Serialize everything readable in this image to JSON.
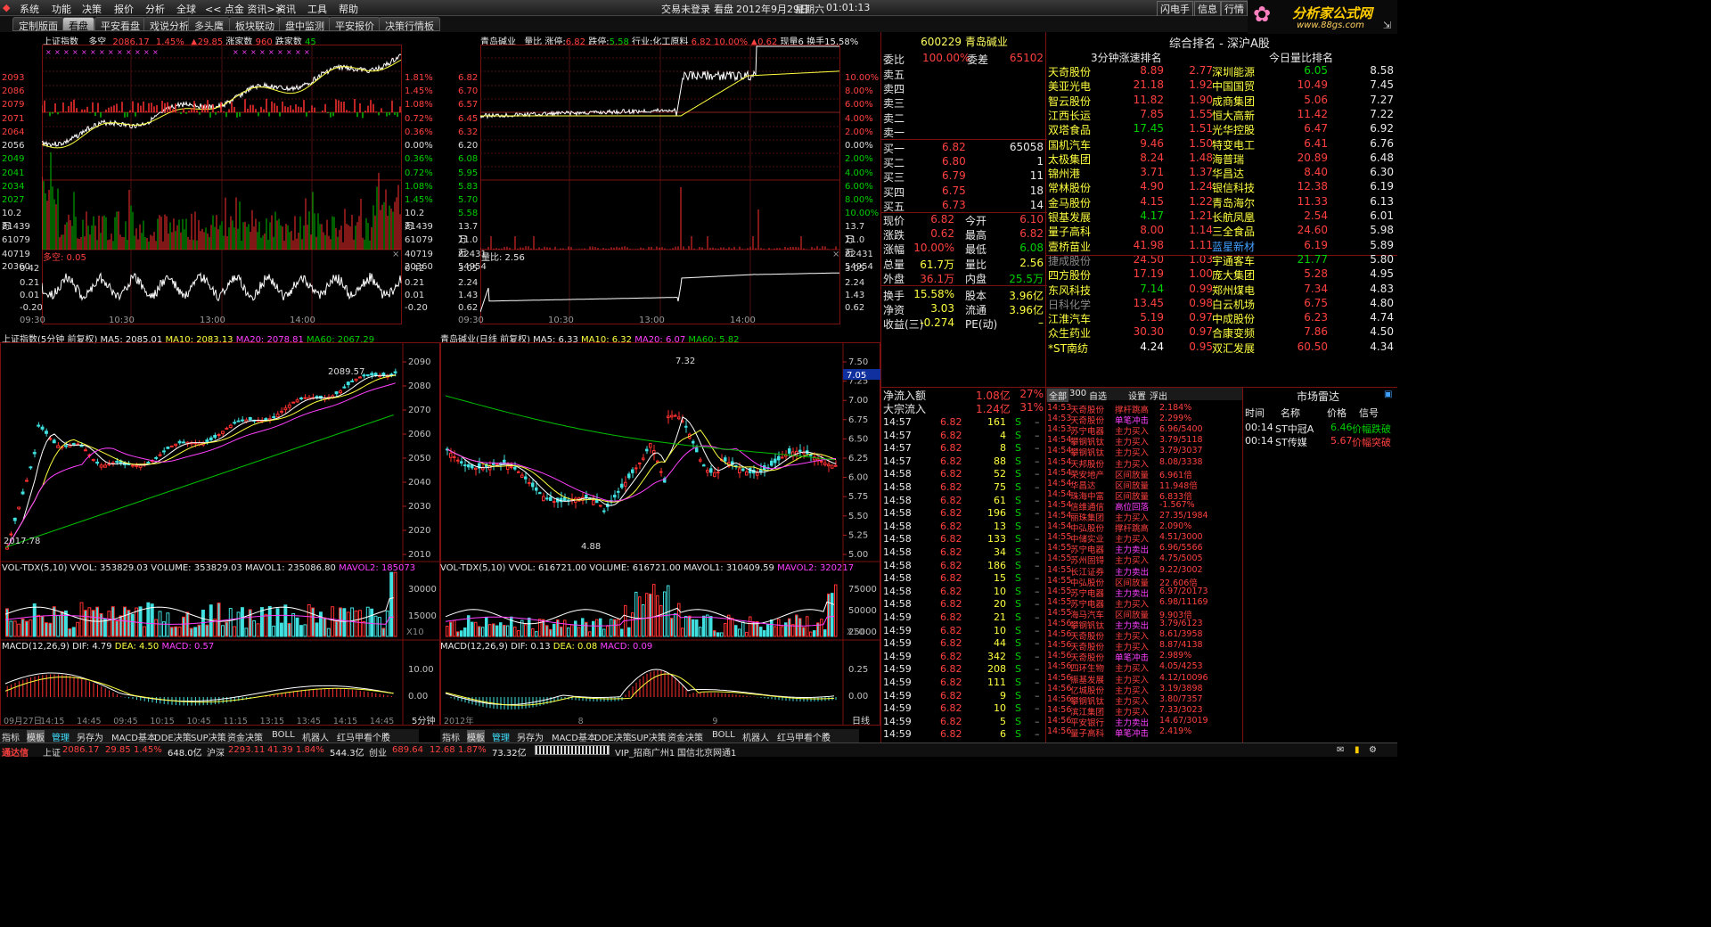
{
  "menu": [
    "系统",
    "功能",
    "决策",
    "报价",
    "分析",
    "全球",
    "<< 点金 资讯>>",
    "资讯",
    "工具",
    "帮助"
  ],
  "status_top": {
    "login": "交易未登录",
    "mode": "看盘",
    "date": "2012年9月29日",
    "weekday": "星期六",
    "time": "01:01:13"
  },
  "top_buttons": [
    "闪电手",
    "信息",
    "行情"
  ],
  "logo": {
    "title": "分析家公式网",
    "url": "www.88gs.com"
  },
  "tabs": [
    "定制版面",
    "看盘",
    "平安看盘",
    "戏说分析",
    "多头鹰",
    "板块联动",
    "盘中监测",
    "平安报价",
    "决策行情板"
  ],
  "left_top": {
    "title": "上证指数",
    "mode": "多空",
    "price": "2086.17",
    "pct": "1.45%",
    "chg": "▲29.85",
    "up_label": "涨家数",
    "up": "960",
    "down_label": "跌家数",
    "down": "45",
    "price_ticks": [
      "2093",
      "2086",
      "2079",
      "2071",
      "2064",
      "2056",
      "2049",
      "2041",
      "2034",
      "2027",
      "10.2万",
      "81439",
      "61079",
      "40719",
      "20360"
    ],
    "pct_ticks": [
      "1.81%",
      "1.45%",
      "1.08%",
      "0.72%",
      "0.36%",
      "0.00%",
      "0.36%",
      "0.72%",
      "1.08%",
      "1.45%",
      "10.2万",
      "81439",
      "61079",
      "40719",
      "20360"
    ],
    "ind_name": "多空: 0.05",
    "ind_ticks": [
      "0.42",
      "0.21",
      "0.01",
      "-0.20"
    ],
    "time_ticks": [
      "09:30",
      "10:30",
      "13:00",
      "14:00"
    ]
  },
  "mid_top": {
    "title": "青岛碱业",
    "mode": "量比",
    "limit_up_label": "涨停:",
    "limit_up": "6.82",
    "limit_down_label": "跌停:",
    "limit_down": "5.58",
    "industry_label": "行业:",
    "industry": "化工原料",
    "price": "6.82",
    "pct": "10.00%",
    "chg": "▲0.62",
    "now_label": "现量",
    "now": "6",
    "turn_label": "换手",
    "turn": "15.58%",
    "price_ticks": [
      "6.82",
      "6.70",
      "6.57",
      "6.45",
      "6.32",
      "6.20",
      "6.08",
      "5.95",
      "5.83",
      "5.70",
      "5.58",
      "13.7万",
      "11.0万",
      "82431",
      "54954",
      "27477"
    ],
    "pct_ticks": [
      "10.00%",
      "8.00%",
      "6.00%",
      "4.00%",
      "2.00%",
      "0.00%",
      "2.00%",
      "4.00%",
      "6.00%",
      "8.00%",
      "10.00%",
      "13.7万",
      "11.0万",
      "82431",
      "54954",
      "27477"
    ],
    "ind_name": "量比: 2.56",
    "ind_ticks": [
      "3.05",
      "2.24",
      "1.43",
      "0.62"
    ],
    "time_ticks": [
      "09:30",
      "10:30",
      "13:00",
      "14:00"
    ]
  },
  "kline_left": {
    "title": "上证指数(5分钟 前复权)",
    "ma5": "MA5: 2085.01",
    "ma10": "MA10: 2083.13",
    "ma20": "MA20: 2078.81",
    "ma60": "MA60: 2067.29",
    "hi_label": "2089.57",
    "lo_label": "2017.78",
    "y_ticks": [
      "2090",
      "2080",
      "2070",
      "2060",
      "2050",
      "2040",
      "2030",
      "2020",
      "2010"
    ],
    "vol_title": "VOL-TDX(5,10)",
    "vol_vals": "VVOL: 353829.03  VOLUME: 353829.03  MAVOL1: 235086.80",
    "mavol2": "MAVOL2: 185073",
    "vol_ticks": [
      "30000",
      "15000"
    ],
    "x10": "X10",
    "macd_title": "MACD(12,26,9)",
    "dif": "DIF: 4.79",
    "dea": "DEA: 4.50",
    "macd": "MACD: 0.57",
    "macd_ticks": [
      "10.00",
      "0.00"
    ],
    "date_ticks": [
      "09月27日",
      "14:15",
      "14:45",
      "09:45",
      "10:15",
      "10:45",
      "11:15",
      "13:15",
      "13:45",
      "14:15",
      "14:45"
    ],
    "period": "5分钟"
  },
  "kline_right": {
    "title": "青岛碱业(日线 前复权)",
    "ma5": "MA5: 6.33",
    "ma10": "MA10: 6.32",
    "ma20": "MA20: 6.07",
    "ma60": "MA60: 5.82",
    "hi_label": "7.32",
    "lo_label": "4.88",
    "cur": "7.05",
    "y_ticks": [
      "7.50",
      "7.25",
      "7.00",
      "6.75",
      "6.50",
      "6.25",
      "6.00",
      "5.75",
      "5.50",
      "5.25",
      "5.00"
    ],
    "vol_title": "VOL-TDX(5,10)",
    "vol_vals": "VVOL: 616721.00  VOLUME: 616721.00  MAVOL1: 310409.59",
    "mavol2": "MAVOL2: 320217",
    "vol_ticks": [
      "75000",
      "50000",
      "25000"
    ],
    "x10": "X10",
    "macd_title": "MACD(12,26,9)",
    "dif": "DIF: 0.13",
    "dea": "DEA: 0.08",
    "macd": "MACD: 0.09",
    "macd_ticks": [
      "0.25",
      "0.00"
    ],
    "date_ticks": [
      "2012年",
      "8",
      "9"
    ],
    "period": "日线"
  },
  "quote": {
    "code": "600229",
    "name": "青岛碱业",
    "wb_label": "委比",
    "wb": "100.00%",
    "wc_label": "委差",
    "wc": "65102",
    "asks": [
      {
        "l": "卖五",
        "p": "",
        "v": ""
      },
      {
        "l": "卖四",
        "p": "",
        "v": ""
      },
      {
        "l": "卖三",
        "p": "",
        "v": ""
      },
      {
        "l": "卖二",
        "p": "",
        "v": ""
      },
      {
        "l": "卖一",
        "p": "",
        "v": ""
      }
    ],
    "bids": [
      {
        "l": "买一",
        "p": "6.82",
        "v": "65058"
      },
      {
        "l": "买二",
        "p": "6.80",
        "v": "1"
      },
      {
        "l": "买三",
        "p": "6.79",
        "v": "11"
      },
      {
        "l": "买四",
        "p": "6.75",
        "v": "18"
      },
      {
        "l": "买五",
        "p": "6.73",
        "v": "14"
      }
    ],
    "stats": [
      [
        "现价",
        "6.82",
        "今开",
        "6.10"
      ],
      [
        "涨跌",
        "0.62",
        "最高",
        "6.82"
      ],
      [
        "涨幅",
        "10.00%",
        "最低",
        "6.08"
      ],
      [
        "总量",
        "61.7万",
        "量比",
        "2.56"
      ],
      [
        "外盘",
        "36.1万",
        "内盘",
        "25.5万"
      ],
      [
        "换手",
        "15.58%",
        "股本",
        "3.96亿"
      ],
      [
        "净资",
        "3.03",
        "流通",
        "3.96亿"
      ],
      [
        "收益(三)",
        "-0.274",
        "PE(动)",
        "–"
      ]
    ]
  },
  "flow": {
    "net_label": "净流入额",
    "net": "1.08亿",
    "net_pct": "27%",
    "block_label": "大宗流入",
    "block": "1.24亿",
    "block_pct": "31%"
  },
  "trades": [
    [
      "14:57",
      "6.82",
      "161",
      "S"
    ],
    [
      "14:57",
      "6.82",
      "4",
      "S"
    ],
    [
      "14:57",
      "6.82",
      "8",
      "S"
    ],
    [
      "14:57",
      "6.82",
      "88",
      "S"
    ],
    [
      "14:58",
      "6.82",
      "52",
      "S"
    ],
    [
      "14:58",
      "6.82",
      "75",
      "S"
    ],
    [
      "14:58",
      "6.82",
      "61",
      "S"
    ],
    [
      "14:58",
      "6.82",
      "196",
      "S"
    ],
    [
      "14:58",
      "6.82",
      "13",
      "S"
    ],
    [
      "14:58",
      "6.82",
      "133",
      "S"
    ],
    [
      "14:58",
      "6.82",
      "34",
      "S"
    ],
    [
      "14:58",
      "6.82",
      "186",
      "S"
    ],
    [
      "14:58",
      "6.82",
      "15",
      "S"
    ],
    [
      "14:58",
      "6.82",
      "10",
      "S"
    ],
    [
      "14:58",
      "6.82",
      "20",
      "S"
    ],
    [
      "14:59",
      "6.82",
      "21",
      "S"
    ],
    [
      "14:59",
      "6.82",
      "10",
      "S"
    ],
    [
      "14:59",
      "6.82",
      "44",
      "S"
    ],
    [
      "14:59",
      "6.82",
      "342",
      "S"
    ],
    [
      "14:59",
      "6.82",
      "208",
      "S"
    ],
    [
      "14:59",
      "6.82",
      "111",
      "S"
    ],
    [
      "14:59",
      "6.82",
      "9",
      "S"
    ],
    [
      "14:59",
      "6.82",
      "10",
      "S"
    ],
    [
      "14:59",
      "6.82",
      "5",
      "S"
    ],
    [
      "14:59",
      "6.82",
      "6",
      "S"
    ]
  ],
  "ranking": {
    "title": "综合排名 - 深沪A股",
    "col1_title": "3分钟涨速排名",
    "col2_title": "今日量比排名",
    "col1": [
      [
        "天奇股份",
        "8.89",
        "2.77"
      ],
      [
        "美亚光电",
        "21.18",
        "1.92"
      ],
      [
        "智云股份",
        "11.82",
        "1.90"
      ],
      [
        "江西长运",
        "7.85",
        "1.55"
      ],
      [
        "双塔食品",
        "17.45",
        "1.51"
      ],
      [
        "国机汽车",
        "9.46",
        "1.50"
      ],
      [
        "太极集团",
        "8.24",
        "1.48"
      ],
      [
        "锦州港",
        "3.71",
        "1.37"
      ],
      [
        "常林股份",
        "4.90",
        "1.24"
      ],
      [
        "金马股份",
        "4.15",
        "1.22"
      ],
      [
        "银基发展",
        "4.17",
        "1.21"
      ],
      [
        "量子高科",
        "8.00",
        "1.14"
      ],
      [
        "壹桥苗业",
        "41.98",
        "1.11"
      ],
      [
        "捷成股份",
        "24.50",
        "1.03"
      ],
      [
        "四方股份",
        "17.19",
        "1.00"
      ],
      [
        "东风科技",
        "7.14",
        "0.99"
      ],
      [
        "日科化学",
        "13.45",
        "0.98"
      ],
      [
        "江淮汽车",
        "5.19",
        "0.97"
      ],
      [
        "众生药业",
        "30.30",
        "0.97"
      ],
      [
        "*ST南纺",
        "4.24",
        "0.95"
      ]
    ],
    "col2": [
      [
        "深圳能源",
        "6.05",
        "8.58"
      ],
      [
        "中国国贸",
        "10.49",
        "7.45"
      ],
      [
        "成商集团",
        "5.06",
        "7.27"
      ],
      [
        "恒大高新",
        "11.42",
        "7.22"
      ],
      [
        "光华控股",
        "6.47",
        "6.92"
      ],
      [
        "特变电工",
        "6.41",
        "6.76"
      ],
      [
        "海普瑞",
        "20.89",
        "6.48"
      ],
      [
        "华昌达",
        "8.40",
        "6.30"
      ],
      [
        "银信科技",
        "12.38",
        "6.19"
      ],
      [
        "青岛海尔",
        "11.33",
        "6.13"
      ],
      [
        "长航凤凰",
        "2.54",
        "6.01"
      ],
      [
        "三全食品",
        "24.60",
        "5.98"
      ],
      [
        "蓝星新材",
        "6.19",
        "5.89"
      ],
      [
        "宇通客车",
        "21.77",
        "5.80"
      ],
      [
        "庞大集团",
        "5.28",
        "4.95"
      ],
      [
        "郑州煤电",
        "7.34",
        "4.83"
      ],
      [
        "白云机场",
        "6.75",
        "4.80"
      ],
      [
        "中成股份",
        "6.23",
        "4.74"
      ],
      [
        "合康变频",
        "7.86",
        "4.50"
      ],
      [
        "双汇发展",
        "60.50",
        "4.34"
      ]
    ]
  },
  "news_tabs": [
    "全部",
    "300",
    "自选",
    "设置",
    "浮出"
  ],
  "news": [
    [
      "14:53",
      "天奇股份",
      "撑杆跳高",
      "2.184%"
    ],
    [
      "14:53",
      "天奇股份",
      "单笔冲击",
      "2.299%"
    ],
    [
      "14:53",
      "苏宁电器",
      "主力买入",
      "6.96/5400"
    ],
    [
      "14:54",
      "攀钢钒钛",
      "主力买入",
      "3.79/5118"
    ],
    [
      "14:54",
      "攀钢钒钛",
      "主力买入",
      "3.79/3037"
    ],
    [
      "14:54",
      "天邦股份",
      "主力买入",
      "8.08/3338"
    ],
    [
      "14:54",
      "荣安地产",
      "区间放量",
      "6.961倍"
    ],
    [
      "14:54",
      "华昌达",
      "区间放量",
      "11.948倍"
    ],
    [
      "14:54",
      "珠海中富",
      "区间放量",
      "6.833倍"
    ],
    [
      "14:54",
      "信维通信",
      "高位回落",
      "-1.567%"
    ],
    [
      "14:54",
      "丽珠集团",
      "主力买入",
      "27.35/1984"
    ],
    [
      "14:54",
      "中弘股份",
      "撑杆跳高",
      "2.090%"
    ],
    [
      "14:55",
      "中储实业",
      "主力买入",
      "4.51/3000"
    ],
    [
      "14:55",
      "苏宁电器",
      "主力卖出",
      "6.96/5566"
    ],
    [
      "14:55",
      "苏州固锝",
      "主力买入",
      "4.75/5005"
    ],
    [
      "14:55",
      "长江证券",
      "主力卖出",
      "9.22/3002"
    ],
    [
      "14:55",
      "中弘股份",
      "区间放量",
      "22.606倍"
    ],
    [
      "14:55",
      "苏宁电器",
      "主力卖出",
      "6.97/20173"
    ],
    [
      "14:55",
      "苏宁电器",
      "主力买入",
      "6.98/11169"
    ],
    [
      "14:55",
      "海马汽车",
      "区间放量",
      "9.903倍"
    ],
    [
      "14:56",
      "攀钢钒钛",
      "主力卖出",
      "3.79/6123"
    ],
    [
      "14:56",
      "天奇股份",
      "主力买入",
      "8.61/3958"
    ],
    [
      "14:56",
      "天奇股份",
      "主力买入",
      "8.87/4138"
    ],
    [
      "14:56",
      "天奇股份",
      "单笔冲击",
      "2.989%"
    ],
    [
      "14:56",
      "四环生物",
      "主力买入",
      "4.05/4253"
    ],
    [
      "14:56",
      "振基发展",
      "主力买入",
      "4.12/10096"
    ],
    [
      "14:56",
      "亿城股份",
      "主力买入",
      "3.19/3898"
    ],
    [
      "14:56",
      "攀钢钒钛",
      "主力买入",
      "3.80/7357"
    ],
    [
      "14:56",
      "滨江集团",
      "主力买入",
      "7.33/3023"
    ],
    [
      "14:56",
      "平安银行",
      "主力卖出",
      "14.67/3019"
    ],
    [
      "14:56",
      "量子高科",
      "单笔冲击",
      "2.419%"
    ]
  ],
  "radar": {
    "title": "市场雷达",
    "cols": [
      "时间",
      "名称",
      "价格",
      "信号"
    ],
    "rows": [
      [
        "00:14",
        "ST中冠A",
        "6.46",
        "价幅跌破"
      ],
      [
        "00:14",
        "ST传媒",
        "5.67",
        "价幅突破"
      ]
    ]
  },
  "bottom_tabs": [
    "指标",
    "模板",
    "管理",
    "另存为",
    "MACD基本",
    "DDE决策",
    "SUP决策",
    "资金决策",
    "BOLL",
    "机器人",
    "红马甲看个股"
  ],
  "status": {
    "brand": "通达信",
    "sh_label": "上证",
    "sh": "2086.17",
    "sh_chg": "29.85",
    "sh_pct": "1.45%",
    "sh_amt": "648.0亿",
    "sz_label": "沪深",
    "sz": "2293.11",
    "sz_chg": "41.39",
    "sz_pct": "1.84%",
    "sz_amt": "544.3亿",
    "cy_label": "创业",
    "cy": "689.64",
    "cy_chg": "12.68",
    "cy_pct": "1.87%",
    "cy_amt": "73.32亿",
    "vip": "VIP_招商广州1",
    "server": "国信北京网通1"
  },
  "colors": {
    "up": "#ff4040",
    "down": "#00d000",
    "ma5": "#ffffff",
    "ma10": "#ffff40",
    "ma20": "#ff40ff",
    "ma60": "#00c000",
    "vol_up": "#ff4040",
    "vol_down": "#40e0e0"
  }
}
